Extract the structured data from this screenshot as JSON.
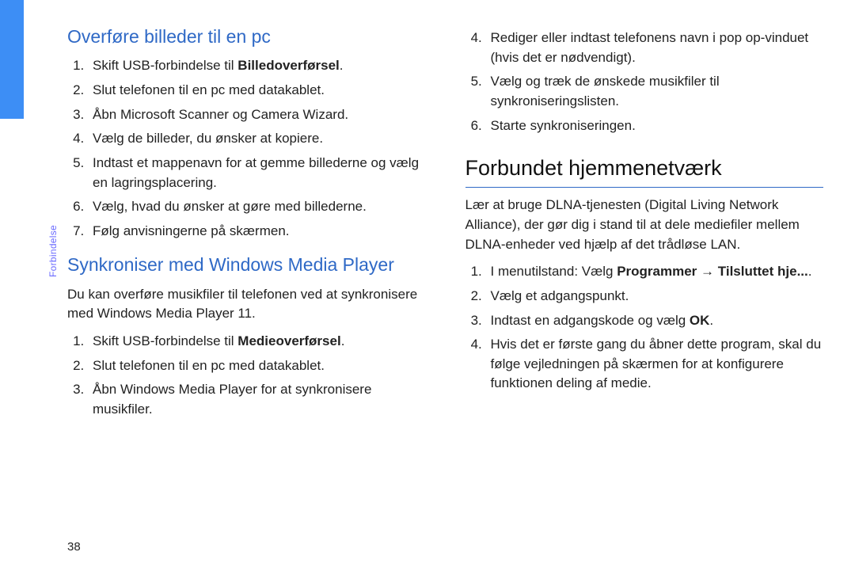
{
  "side_label": "Forbindelse",
  "page_number": "38",
  "left": {
    "h2a": "Overføre billeder til en pc",
    "list_a": {
      "i1_pre": "Skift USB-forbindelse til ",
      "i1_bold": "Billedoverførsel",
      "i1_post": ".",
      "i2": "Slut telefonen til en pc med datakablet.",
      "i3": "Åbn Microsoft Scanner og Camera Wizard.",
      "i4": "Vælg de billeder, du ønsker at kopiere.",
      "i5": "Indtast et mappenavn for at gemme billederne og vælg en lagringsplacering.",
      "i6": "Vælg, hvad du ønsker at gøre med billederne.",
      "i7": "Følg anvisningerne på skærmen."
    },
    "h2b": "Synkroniser med Windows Media Player",
    "para_b": "Du kan overføre musikfiler til telefonen ved at synkronisere med Windows Media Player 11.",
    "list_b": {
      "i1_pre": "Skift USB-forbindelse til ",
      "i1_bold": "Medieoverførsel",
      "i1_post": ".",
      "i2": "Slut telefonen til en pc med datakablet.",
      "i3": "Åbn Windows Media Player for at synkronisere musikfiler."
    }
  },
  "right": {
    "list_top": {
      "start": 4,
      "i4": "Rediger eller indtast telefonens navn i pop op-vinduet (hvis det er nødvendigt).",
      "i5": "Vælg og træk de ønskede musikfiler til synkroniseringslisten.",
      "i6": "Starte synkroniseringen."
    },
    "h1": "Forbundet hjemmenetværk",
    "para": "Lær at bruge DLNA-tjenesten (Digital Living Network Alliance), der gør dig i stand til at dele mediefiler mellem DLNA-enheder ved hjælp af det trådløse LAN.",
    "list_bottom": {
      "i1_pre": "I menutilstand: Vælg ",
      "i1_b1": "Programmer",
      "i1_arrow": " → ",
      "i1_b2": "Tilsluttet hje...",
      "i1_post": ".",
      "i2": "Vælg et adgangspunkt.",
      "i3_pre": "Indtast en adgangskode og vælg ",
      "i3_bold": "OK",
      "i3_post": ".",
      "i4": "Hvis det er første gang du åbner dette program, skal du følge vejledningen på skærmen for at konfigurere funktionen deling af medie."
    }
  }
}
